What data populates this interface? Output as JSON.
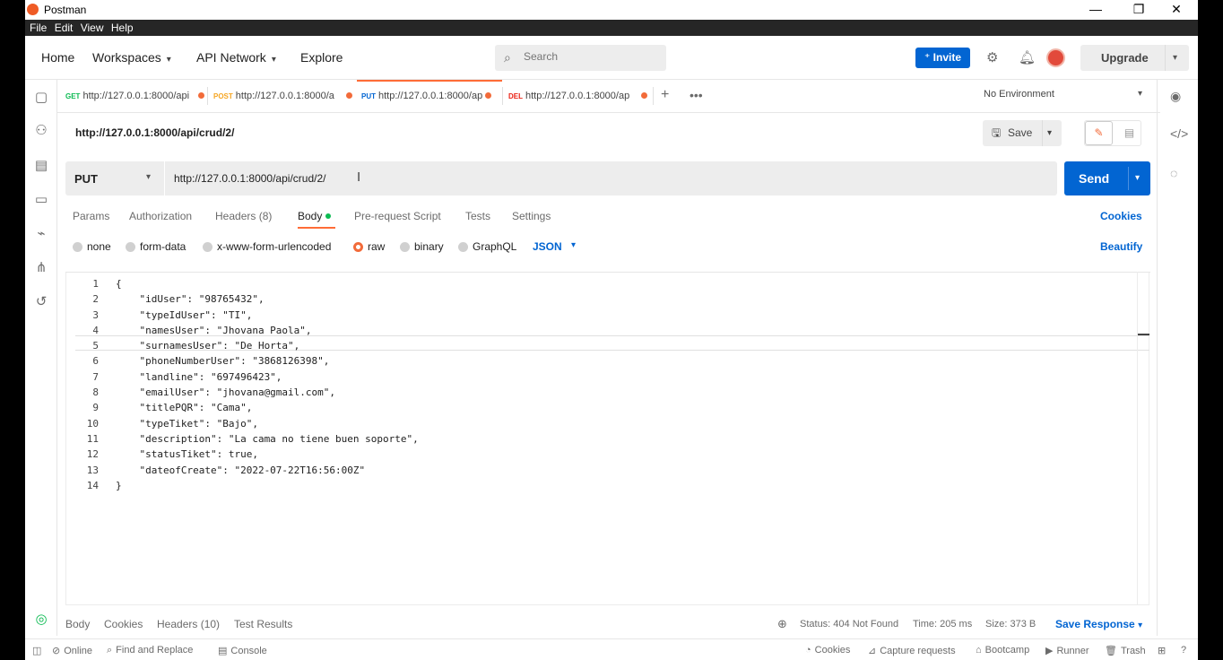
{
  "window": {
    "title": "Postman",
    "minimize": "—",
    "restore": "❐",
    "close": "✕"
  },
  "menu": [
    "File",
    "Edit",
    "View",
    "Help"
  ],
  "header": {
    "nav": [
      "Home",
      "Workspaces",
      "API Network",
      "Explore"
    ],
    "search_placeholder": "Search",
    "invite_label": "Invite",
    "upgrade_label": "Upgrade"
  },
  "tabs": [
    {
      "method": "GET",
      "method_color": "#0cbb52",
      "url": "http://127.0.0.1:8000/api"
    },
    {
      "method": "POST",
      "method_color": "#f6a623",
      "url": "http://127.0.0.1:8000/a"
    },
    {
      "method": "PUT",
      "method_color": "#0265d2",
      "url": "http://127.0.0.1:8000/ap"
    },
    {
      "method": "DEL",
      "method_color": "#eb2013",
      "url": "http://127.0.0.1:8000/ap"
    }
  ],
  "environment": "No Environment",
  "request": {
    "title": "http://127.0.0.1:8000/api/crud/2/",
    "method": "PUT",
    "url": "http://127.0.0.1:8000/api/crud/2/",
    "save_label": "Save",
    "send_label": "Send"
  },
  "request_tabs": [
    "Params",
    "Authorization",
    "Headers (8)",
    "Body",
    "Pre-request Script",
    "Tests",
    "Settings"
  ],
  "cookies_label": "Cookies",
  "body_types": [
    "none",
    "form-data",
    "x-www-form-urlencoded",
    "raw",
    "binary",
    "GraphQL"
  ],
  "selected_body_type": "raw",
  "format": "JSON",
  "beautify_label": "Beautify",
  "editor": {
    "line_numbers": [
      "1",
      "2",
      "3",
      "4",
      "5",
      "6",
      "7",
      "8",
      "9",
      "10",
      "11",
      "12",
      "13",
      "14"
    ],
    "lines": [
      "{",
      "    \"idUser\": \"98765432\",",
      "    \"typeIdUser\": \"TI\",",
      "    \"namesUser\": \"Jhovana Paola\",",
      "    \"surnamesUser\": \"De Horta\",",
      "    \"phoneNumberUser\": \"3868126398\",",
      "    \"landline\": \"697496423\",",
      "    \"emailUser\": \"jhovana@gmail.com\",",
      "    \"titlePQR\": \"Cama\",",
      "    \"typeTiket\": \"Bajo\",",
      "    \"description\": \"La cama no tiene buen soporte\",",
      "    \"statusTiket\": true,",
      "    \"dateofCreate\": \"2022-07-22T16:56:00Z\"",
      "}"
    ]
  },
  "response": {
    "tabs": [
      "Body",
      "Cookies",
      "Headers (10)",
      "Test Results"
    ],
    "status": "Status: 404 Not Found",
    "time": "Time: 205 ms",
    "size": "Size: 373 B",
    "save_label": "Save Response"
  },
  "footer": {
    "online": "Online",
    "find_replace": "Find and Replace",
    "console": "Console",
    "cookies": "Cookies",
    "capture": "Capture requests",
    "bootcamp": "Bootcamp",
    "runner": "Runner",
    "trash": "Trash"
  }
}
